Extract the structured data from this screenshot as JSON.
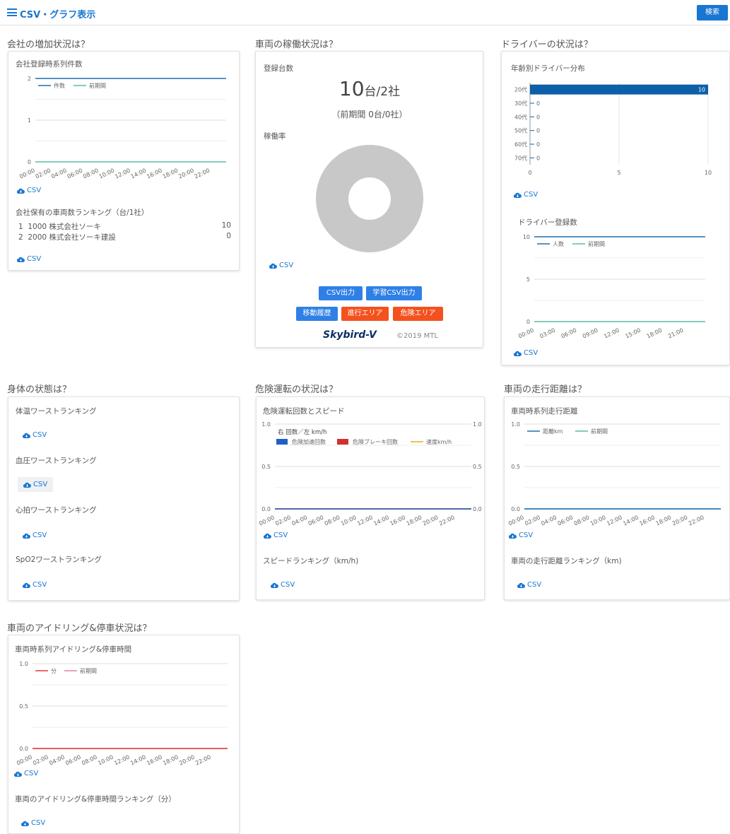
{
  "header": {
    "title": "CSV・グラフ表示",
    "search_label": "検索"
  },
  "csv_label": "CSV",
  "colors": {
    "accent": "#1976d2",
    "line_primary": "#1f6fb2",
    "line_prev": "#5fb8a8",
    "orange": "#f4511e",
    "idle_red": "#e53935",
    "idle_pink": "#e880a0",
    "speed_yellow": "#f5a623"
  },
  "companies": {
    "section_title": "会社の増加状況は？",
    "chart_title": "会社登録時系列件数",
    "ranking_title": "会社保有の車両数ランキング（台/1社）",
    "ranking": [
      {
        "rank": "1",
        "name": "1000 株式会社ソーキ",
        "value": "10"
      },
      {
        "rank": "2",
        "name": "2000 株式会社ソーキ建設",
        "value": "0"
      }
    ]
  },
  "vehicles": {
    "section_title": "車両の稼働状況は？",
    "registered_label": "登録台数",
    "registered_value": "10",
    "registered_unit": "台/2社",
    "prev_period": "（前期間 0台/0社）",
    "utilization_label": "稼働率",
    "buttons": {
      "csv_out": "CSV出力",
      "learn_csv": "学習CSV出力",
      "move_history": "移動履歴",
      "entry_area": "進行エリア",
      "danger_area": "危険エリア"
    },
    "brand": "Skybird-V",
    "copyright": "©2019 MTL"
  },
  "drivers": {
    "section_title": "ドライバーの状況は？",
    "age_chart_title": "年齢別ドライバー分布",
    "reg_chart_title": "ドライバー登録数"
  },
  "body": {
    "section_title": "身体の状態は？",
    "items": [
      "体温ワーストランキング",
      "血圧ワーストランキング",
      "心拍ワーストランキング",
      "SpO2ワーストランキング"
    ]
  },
  "danger": {
    "section_title": "危険運転の状況は？",
    "chart_title": "危険運転回数とスピード",
    "ranking_title": "スピードランキング（km/h)"
  },
  "distance": {
    "section_title": "車両の走行距離は？",
    "chart_title": "車両時系列走行距離",
    "ranking_title": "車両の走行距離ランキング（km)"
  },
  "idling": {
    "section_title": "車両のアイドリング&停車状況は？",
    "chart_title": "車両時系列アイドリング&停車時間",
    "ranking_title": "車両のアイドリング&停車時間ランキング（分）"
  },
  "chart_data": [
    {
      "type": "line",
      "x": [
        "00:00",
        "02:00",
        "04:00",
        "06:00",
        "08:00",
        "10:00",
        "12:00",
        "14:00",
        "16:00",
        "18:00",
        "20:00",
        "22:00"
      ],
      "series": [
        {
          "name": "件数",
          "values": [
            2,
            2,
            2,
            2,
            2,
            2,
            2,
            2,
            2,
            2,
            2,
            2
          ]
        },
        {
          "name": "前期間",
          "values": [
            0,
            0,
            0,
            0,
            0,
            0,
            0,
            0,
            0,
            0,
            0,
            0
          ]
        }
      ],
      "ylim": [
        0,
        2
      ],
      "yticks": [
        "2",
        "1",
        "0"
      ],
      "legend": "top-left"
    },
    {
      "type": "pie",
      "values": [
        1
      ],
      "colors": [
        "#c8c8c8"
      ],
      "donut": true
    },
    {
      "type": "bar",
      "orientation": "horizontal",
      "categories": [
        "20代",
        "30代",
        "40代",
        "50代",
        "60代",
        "70代"
      ],
      "values": [
        10,
        0,
        0,
        0,
        0,
        0
      ],
      "xlim": [
        0,
        10
      ],
      "xticks": [
        "0",
        "5",
        "10"
      ]
    },
    {
      "type": "line",
      "x": [
        "00:00",
        "03:00",
        "06:00",
        "09:00",
        "12:00",
        "15:00",
        "18:00",
        "21:00"
      ],
      "series": [
        {
          "name": "人数",
          "values": [
            10,
            10,
            10,
            10,
            10,
            10,
            10,
            10
          ]
        },
        {
          "name": "前期間",
          "values": [
            0,
            0,
            0,
            0,
            0,
            0,
            0,
            0
          ]
        }
      ],
      "ylim": [
        0,
        10
      ],
      "yticks": [
        "10",
        "5",
        "0"
      ],
      "legend": "top-left"
    },
    {
      "type": "line",
      "x": [
        "00:00",
        "02:00",
        "04:00",
        "06:00",
        "08:00",
        "10:00",
        "12:00",
        "14:00",
        "16:00",
        "18:00",
        "20:00",
        "22:00"
      ],
      "axis_note": "右 回数／左 km/h",
      "series": [
        {
          "name": "危険加速回数",
          "values": [
            0,
            0,
            0,
            0,
            0,
            0,
            0,
            0,
            0,
            0,
            0,
            0
          ]
        },
        {
          "name": "危険ブレーキ回数",
          "values": [
            0,
            0,
            0,
            0,
            0,
            0,
            0,
            0,
            0,
            0,
            0,
            0
          ]
        },
        {
          "name": "速度km/h",
          "values": [
            0,
            0,
            0,
            0,
            0,
            0,
            0,
            0,
            0,
            0,
            0,
            0
          ]
        }
      ],
      "ylim": [
        0,
        1
      ],
      "yticks": [
        "1.0",
        "0.5",
        "0.0"
      ],
      "legend": "top-left"
    },
    {
      "type": "line",
      "x": [
        "00:00",
        "02:00",
        "04:00",
        "06:00",
        "08:00",
        "10:00",
        "12:00",
        "14:00",
        "16:00",
        "18:00",
        "20:00",
        "22:00"
      ],
      "series": [
        {
          "name": "距離km",
          "values": [
            0,
            0,
            0,
            0,
            0,
            0,
            0,
            0,
            0,
            0,
            0,
            0
          ]
        },
        {
          "name": "前期間",
          "values": [
            0,
            0,
            0,
            0,
            0,
            0,
            0,
            0,
            0,
            0,
            0,
            0
          ]
        }
      ],
      "ylim": [
        0,
        1
      ],
      "yticks": [
        "1.0",
        "0.5",
        "0.0"
      ],
      "legend": "top-left"
    },
    {
      "type": "line",
      "x": [
        "00:00",
        "02:00",
        "04:00",
        "06:00",
        "08:00",
        "10:00",
        "12:00",
        "14:00",
        "16:00",
        "18:00",
        "20:00",
        "22:00"
      ],
      "series": [
        {
          "name": "分",
          "values": [
            0,
            0,
            0,
            0,
            0,
            0,
            0,
            0,
            0,
            0,
            0,
            0
          ]
        },
        {
          "name": "前期間",
          "values": [
            0,
            0,
            0,
            0,
            0,
            0,
            0,
            0,
            0,
            0,
            0,
            0
          ]
        }
      ],
      "ylim": [
        0,
        1
      ],
      "yticks": [
        "1.0",
        "0.5",
        "0.0"
      ],
      "legend": "top-left"
    }
  ]
}
